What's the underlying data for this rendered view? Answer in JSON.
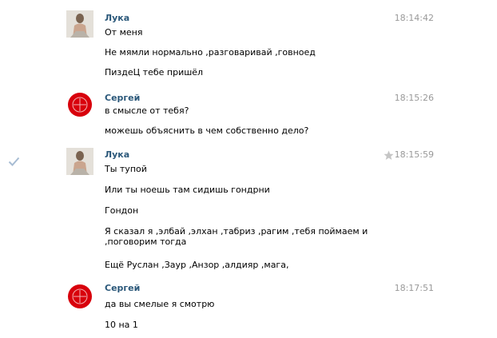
{
  "messages": [
    {
      "sender": "Лука",
      "time": "18:14:42",
      "avatar": "user-photo",
      "lines": [
        "От меня",
        "Не мямли нормально ,разговаривай ,говноед",
        "ПиздеЦ тебе пришёл"
      ]
    },
    {
      "sender": "Сергей",
      "time": "18:15:26",
      "avatar": "red-emblem",
      "lines": [
        "в смысле от тебя?",
        "можешь объяснить в чем собственно дело?"
      ]
    },
    {
      "sender": "Лука",
      "time": "18:15:59",
      "avatar": "user-photo",
      "starred": false,
      "lines": [
        "Ты тупой",
        "Или ты ноешь там сидишь гондрни",
        "Гондон",
        "Я сказал я ,элбай ,элхан ,табриз ,рагим ,тебя поймаем и ,поговорим тогда",
        "Ещё Руслан ,Заур ,Анзор ,алдияр ,мага,"
      ]
    },
    {
      "sender": "Сергей",
      "time": "18:17:51",
      "avatar": "red-emblem",
      "lines": [
        "да вы смелые я смотрю",
        "10 на 1"
      ]
    }
  ],
  "icons": {
    "read_check": "check-icon",
    "star": "star-icon"
  },
  "colors": {
    "sender_name": "#2b587a",
    "timestamp": "#999999",
    "text": "#000000",
    "emblem_red": "#d8000c",
    "check": "#a7bcd3",
    "star": "#c5c5c5"
  }
}
